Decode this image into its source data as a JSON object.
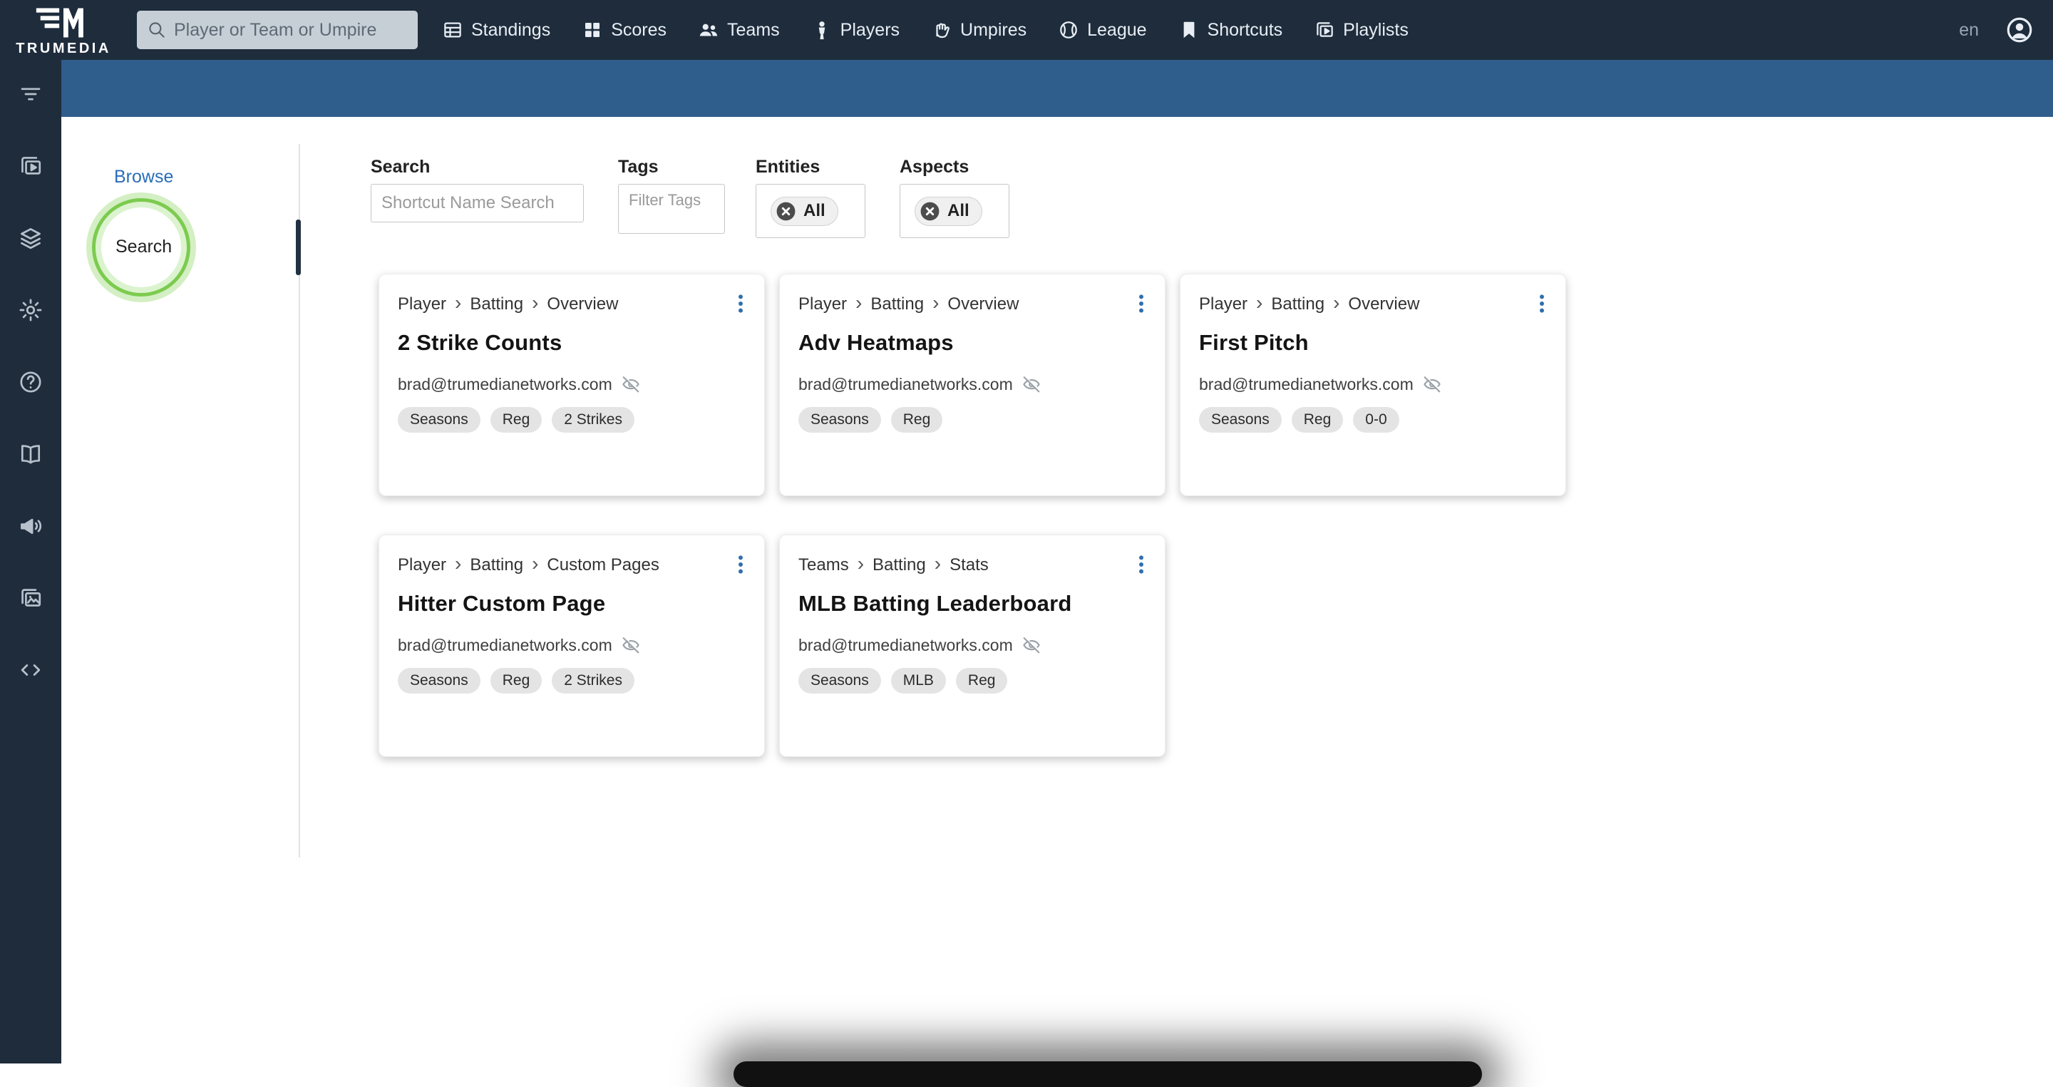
{
  "topbar": {
    "brand": "TRUMEDIA",
    "search": {
      "placeholder": "Player or Team or Umpire",
      "icon": "search"
    },
    "nav": [
      {
        "label": "Standings",
        "icon": "standings"
      },
      {
        "label": "Scores",
        "icon": "scores"
      },
      {
        "label": "Teams",
        "icon": "teams"
      },
      {
        "label": "Players",
        "icon": "players"
      },
      {
        "label": "Umpires",
        "icon": "umpires"
      },
      {
        "label": "League",
        "icon": "league"
      },
      {
        "label": "Shortcuts",
        "icon": "shortcuts"
      },
      {
        "label": "Playlists",
        "icon": "playlists"
      }
    ],
    "language": "en",
    "account_icon": "account"
  },
  "sidebar": {
    "items": [
      {
        "icon": "filter"
      },
      {
        "icon": "video-playlist"
      },
      {
        "icon": "layers"
      },
      {
        "icon": "settings"
      },
      {
        "icon": "help"
      },
      {
        "icon": "book"
      },
      {
        "icon": "megaphone"
      },
      {
        "icon": "gallery"
      },
      {
        "icon": "code"
      }
    ]
  },
  "browse_panel": {
    "browse_label": "Browse",
    "search_label": "Search"
  },
  "filters": {
    "search": {
      "label": "Search",
      "placeholder": "Shortcut Name Search"
    },
    "tags": {
      "label": "Tags",
      "placeholder": "Filter Tags"
    },
    "entities": {
      "label": "Entities",
      "value": "All"
    },
    "aspects": {
      "label": "Aspects",
      "value": "All"
    }
  },
  "cards": [
    {
      "breadcrumb": [
        "Player",
        "Batting",
        "Overview"
      ],
      "title": "2 Strike Counts",
      "owner": "brad@trumedianetworks.com",
      "tags": [
        "Seasons",
        "Reg",
        "2 Strikes"
      ]
    },
    {
      "breadcrumb": [
        "Player",
        "Batting",
        "Overview"
      ],
      "title": "Adv Heatmaps",
      "owner": "brad@trumedianetworks.com",
      "tags": [
        "Seasons",
        "Reg"
      ]
    },
    {
      "breadcrumb": [
        "Player",
        "Batting",
        "Overview"
      ],
      "title": "First Pitch",
      "owner": "brad@trumedianetworks.com",
      "tags": [
        "Seasons",
        "Reg",
        "0-0"
      ]
    },
    {
      "breadcrumb": [
        "Player",
        "Batting",
        "Custom Pages"
      ],
      "title": "Hitter Custom Page",
      "owner": "brad@trumedianetworks.com",
      "tags": [
        "Seasons",
        "Reg",
        "2 Strikes"
      ]
    },
    {
      "breadcrumb": [
        "Teams",
        "Batting",
        "Stats"
      ],
      "title": "MLB Batting Leaderboard",
      "owner": "brad@trumedianetworks.com",
      "tags": [
        "Seasons",
        "MLB",
        "Reg"
      ]
    }
  ],
  "colors": {
    "topbar_bg": "#1e2c3c",
    "header_bar_bg": "#2f5d8c",
    "accent_blue": "#2a6db8",
    "highlight_green": "#7ccb4f"
  }
}
